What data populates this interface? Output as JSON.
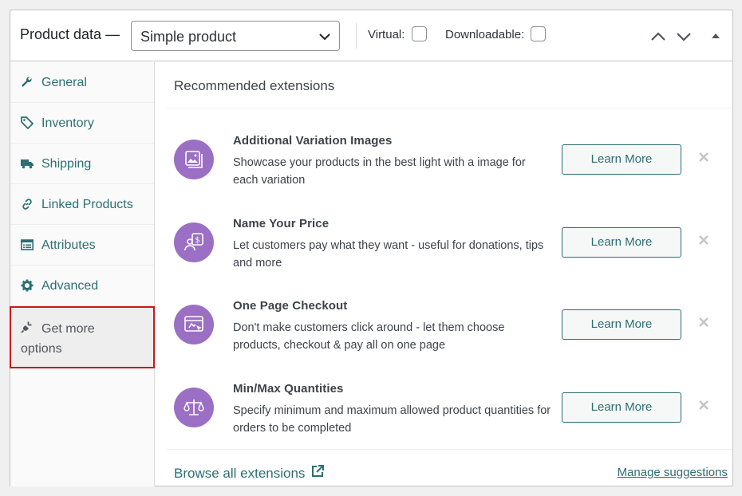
{
  "header": {
    "title": "Product data —",
    "product_type": {
      "selected": "Simple product"
    },
    "virtual_label": "Virtual:",
    "downloadable_label": "Downloadable:"
  },
  "sidebar": {
    "items": [
      {
        "label": "General",
        "icon": "wrench-icon"
      },
      {
        "label": "Inventory",
        "icon": "tag-icon"
      },
      {
        "label": "Shipping",
        "icon": "truck-icon"
      },
      {
        "label": "Linked Products",
        "icon": "link-icon"
      },
      {
        "label": "Attributes",
        "icon": "list-card-icon"
      },
      {
        "label": "Advanced",
        "icon": "gear-icon"
      },
      {
        "label": "Get more options",
        "icon": "plug-icon",
        "active": true
      }
    ]
  },
  "content": {
    "title": "Recommended extensions",
    "extensions": [
      {
        "name": "Additional Variation Images",
        "description": "Showcase your products in the best light with a image for each variation",
        "button": "Learn More",
        "icon": "images-icon"
      },
      {
        "name": "Name Your Price",
        "description": "Let customers pay what they want - useful for donations, tips and more",
        "button": "Learn More",
        "icon": "price-icon"
      },
      {
        "name": "One Page Checkout",
        "description": "Don't make customers click around - let them choose products, checkout & pay all on one page",
        "button": "Learn More",
        "icon": "checkout-icon"
      },
      {
        "name": "Min/Max Quantities",
        "description": "Specify minimum and maximum allowed product quantities for orders to be completed",
        "button": "Learn More",
        "icon": "scale-icon"
      }
    ],
    "browse_label": "Browse all extensions",
    "manage_label": "Manage suggestions"
  },
  "colors": {
    "accent": "#2c6e73",
    "icon_bg": "#9b6fc4",
    "highlight_border": "#cc1818"
  }
}
